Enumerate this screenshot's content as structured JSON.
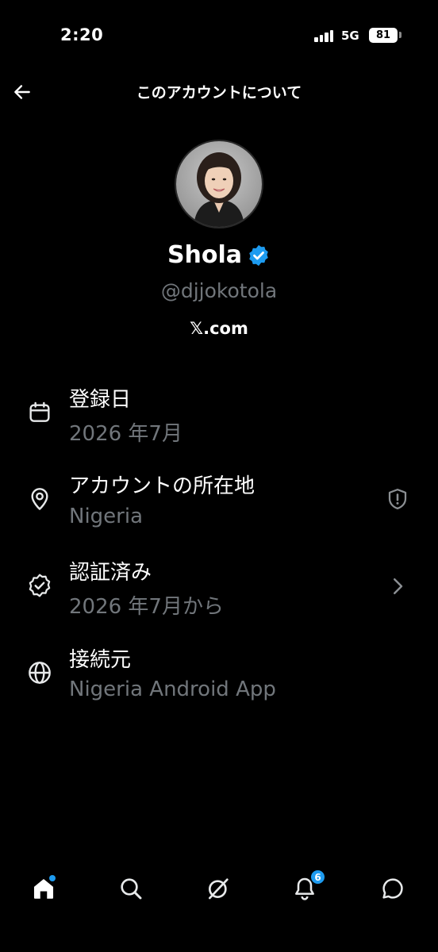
{
  "status_bar": {
    "time": "2:20",
    "network": "5G",
    "battery": "81"
  },
  "header": {
    "title": "このアカウントについて"
  },
  "profile": {
    "name": "Shola",
    "handle": "@djjokotola",
    "site": "𝕏.com",
    "verified": true
  },
  "info": [
    {
      "label": "登録日",
      "value": "2026 年7月",
      "icon": "calendar-icon"
    },
    {
      "label": "アカウントの所在地",
      "value": "Nigeria",
      "icon": "location-pin-icon",
      "aux_icon": "shield-icon"
    },
    {
      "label": "認証済み",
      "value": "2026 年7月から",
      "icon": "verified-badge-icon",
      "aux_icon": "chevron-right-icon"
    },
    {
      "label": "接続元",
      "value": "Nigeria Android App",
      "icon": "globe-icon"
    }
  ],
  "bottom_nav": {
    "items": [
      "home-icon",
      "search-icon",
      "grok-icon",
      "notifications-icon",
      "messages-icon"
    ],
    "notifications_badge": "6"
  },
  "colors": {
    "accent": "#1d9bf0",
    "text_primary": "#ffffff",
    "text_secondary": "#71767b",
    "background": "#000000"
  }
}
